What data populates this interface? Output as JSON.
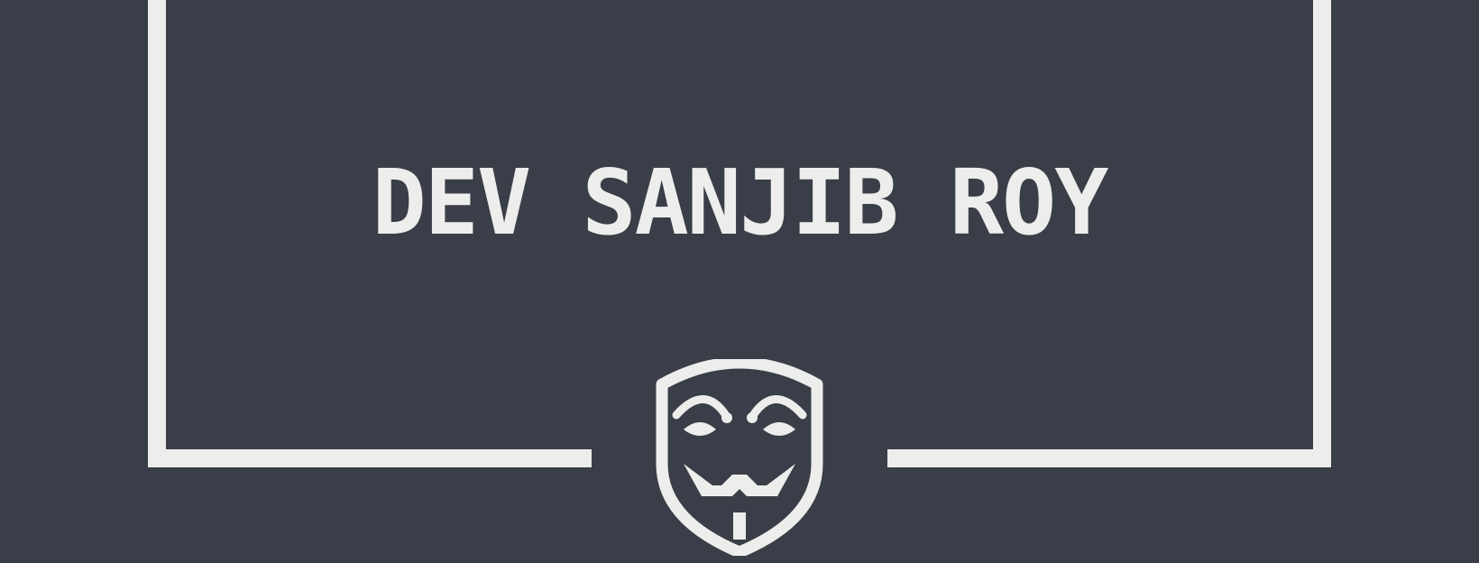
{
  "banner": {
    "title": "DEV SANJIB ROY",
    "logo_icon": "guy-fawkes-mask-icon"
  },
  "colors": {
    "background": "#393e48",
    "foreground": "#ededeb"
  }
}
